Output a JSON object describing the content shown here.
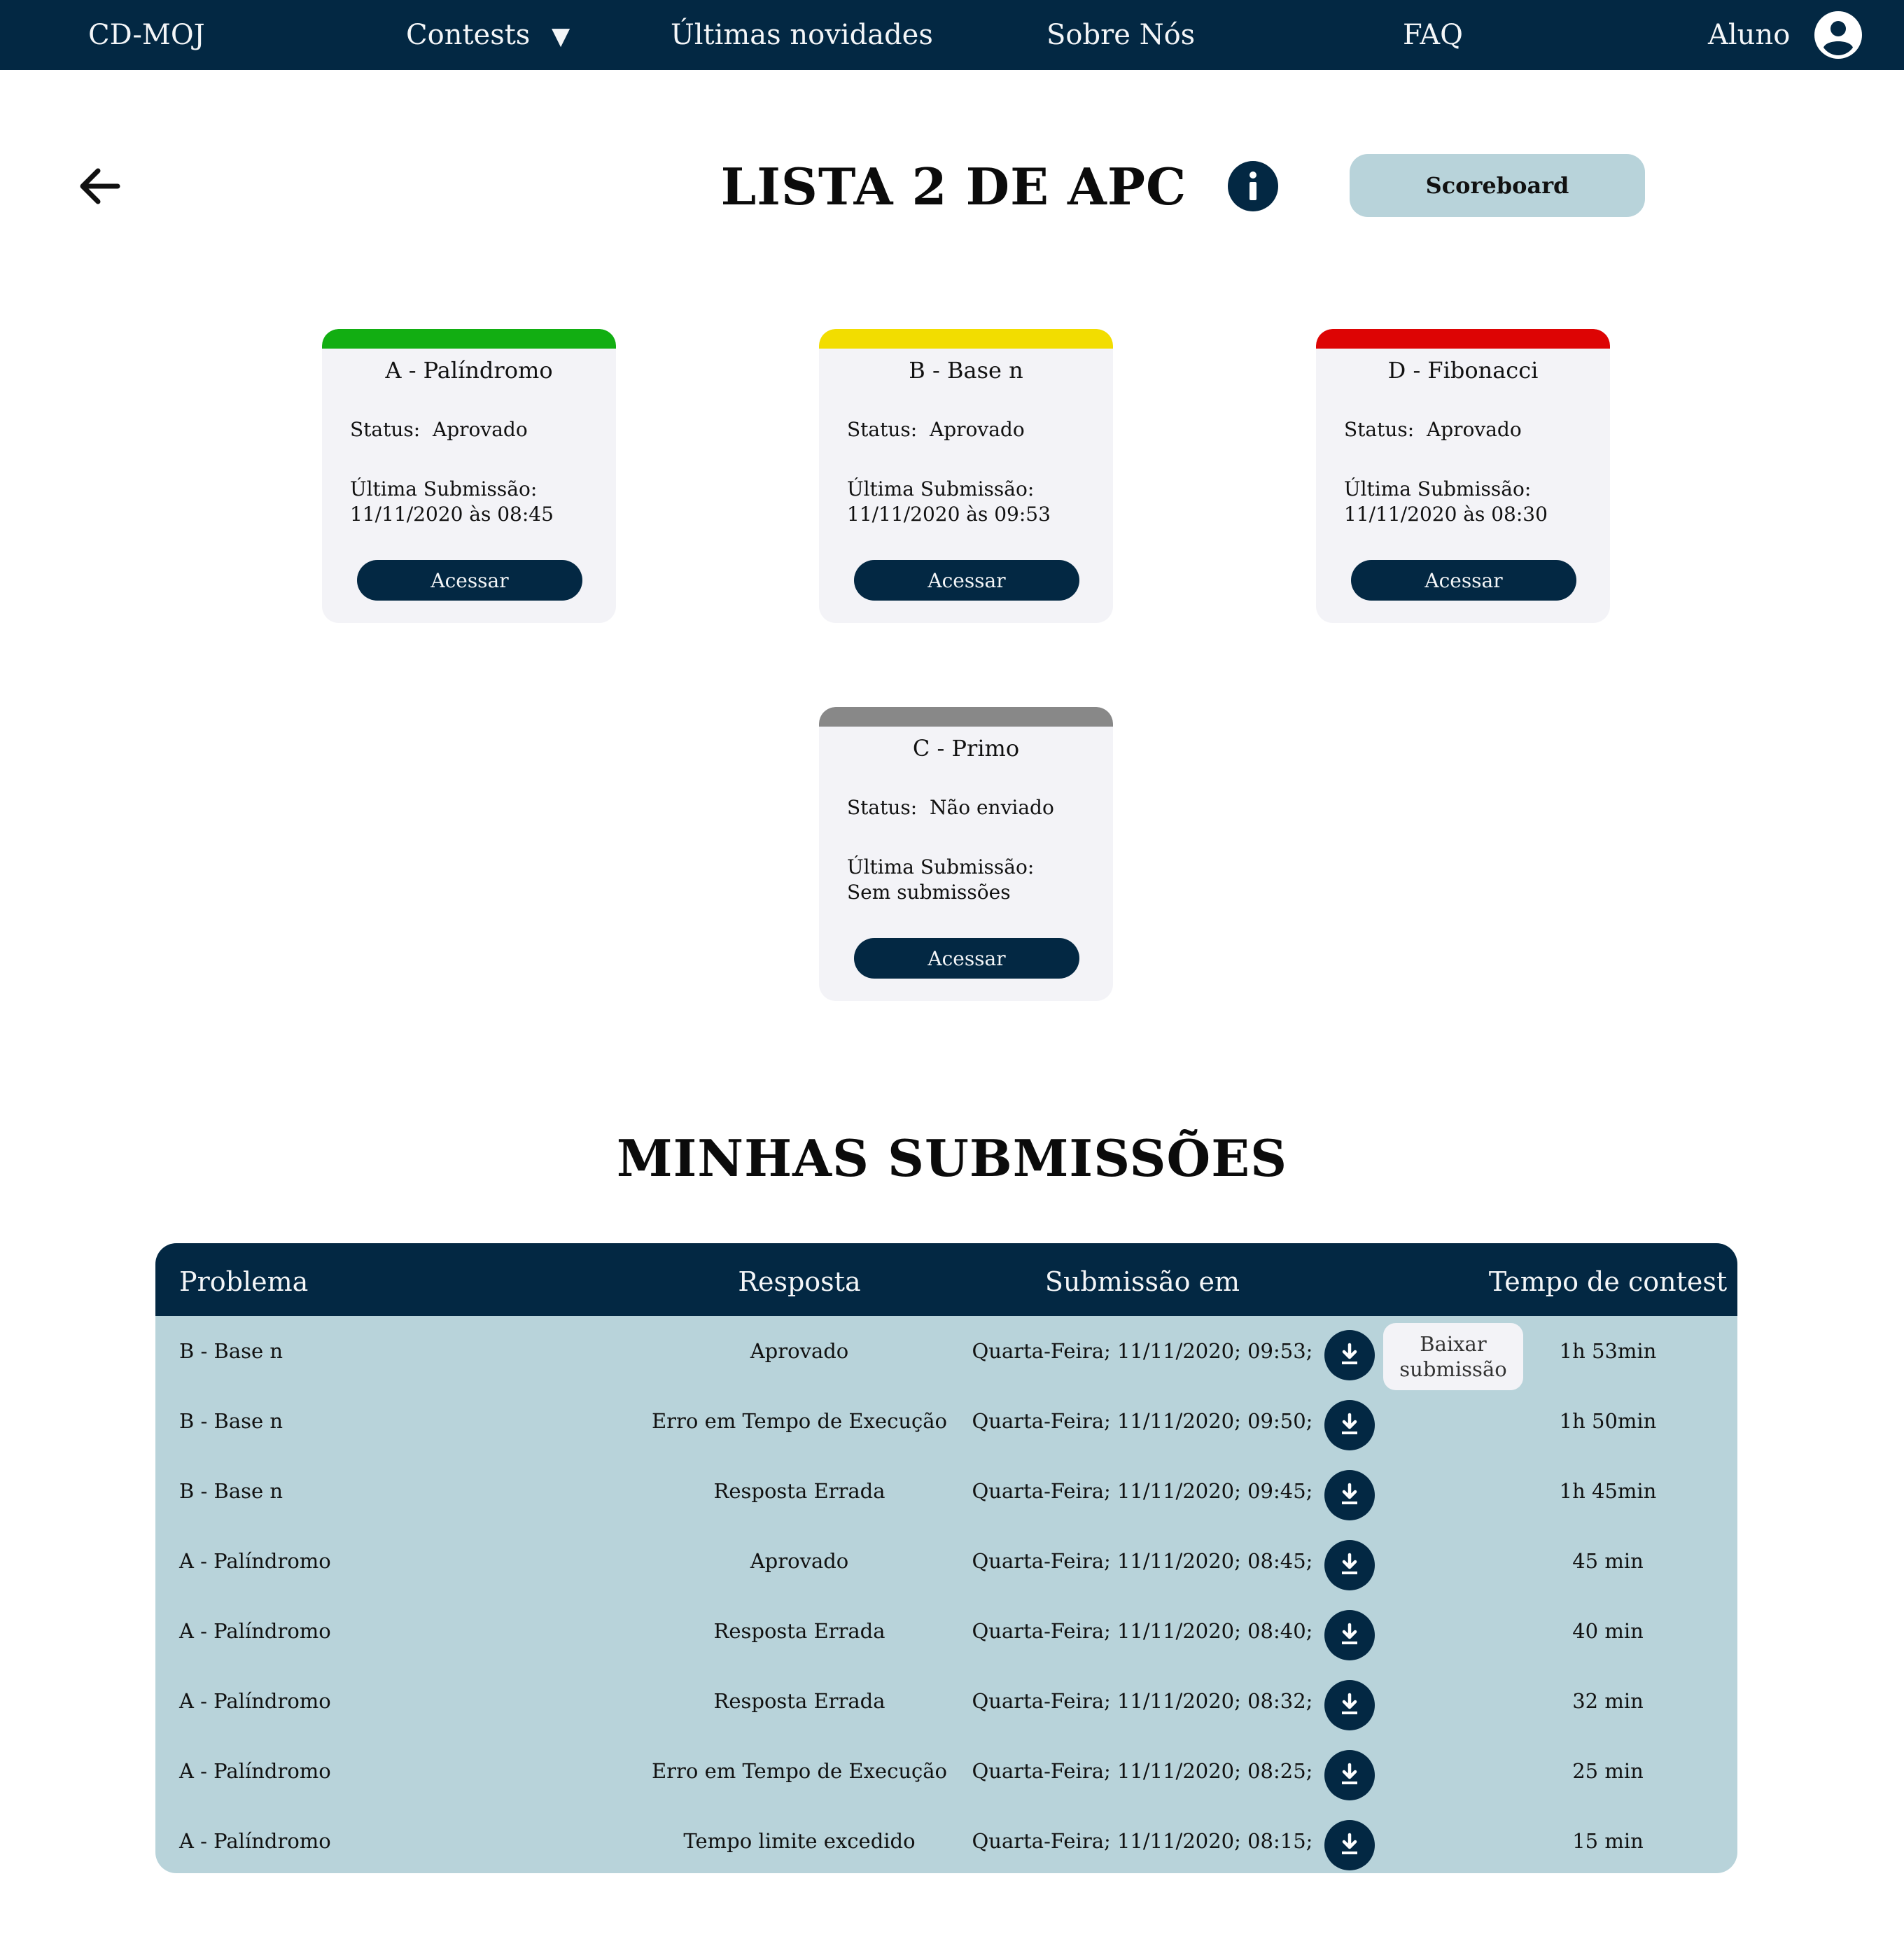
{
  "nav": {
    "brand": "CD-MOJ",
    "contests": "Contests",
    "contests_caret": "▼",
    "news": "Últimas novidades",
    "about": "Sobre Nós",
    "faq": "FAQ",
    "user": "Aluno"
  },
  "header": {
    "title": "LISTA 2 DE APC",
    "scoreboard_label": "Scoreboard"
  },
  "problems": [
    {
      "title": "A - Palíndromo",
      "status_text": "Status:  Aprovado",
      "last_sub_label": "Última Submissão:",
      "last_sub_value": "11/11/2020 às 08:45",
      "button": "Acessar",
      "color": "#12ae12"
    },
    {
      "title": "B - Base n",
      "status_text": "Status:  Aprovado",
      "last_sub_label": "Última Submissão:",
      "last_sub_value": "11/11/2020 às 09:53",
      "button": "Acessar",
      "color": "#f2dd00"
    },
    {
      "title": "D - Fibonacci",
      "status_text": "Status:  Aprovado",
      "last_sub_label": "Última Submissão:",
      "last_sub_value": "11/11/2020 às 08:30",
      "button": "Acessar",
      "color": "#dd0404"
    },
    {
      "title": "C - Primo",
      "status_text": "Status:  Não enviado",
      "last_sub_label": "Última Submissão:",
      "last_sub_value": "Sem submissões",
      "button": "Acessar",
      "color": "#888888"
    }
  ],
  "submissions": {
    "title": "MINHAS SUBMISSÕES",
    "columns": {
      "problem": "Problema",
      "answer": "Resposta",
      "submitted": "Submissão em",
      "time": "Tempo de contest"
    },
    "tooltip": "Baixar submissão",
    "rows": [
      {
        "problem": "B - Base n",
        "answer": "Aprovado",
        "submitted": "Quarta-Feira; 11/11/2020; 09:53;",
        "time": "1h 53min"
      },
      {
        "problem": "B - Base n",
        "answer": "Erro em Tempo de Execução",
        "submitted": "Quarta-Feira; 11/11/2020; 09:50;",
        "time": "1h 50min"
      },
      {
        "problem": "B - Base n",
        "answer": "Resposta Errada",
        "submitted": "Quarta-Feira; 11/11/2020; 09:45;",
        "time": "1h 45min"
      },
      {
        "problem": "A - Palíndromo",
        "answer": "Aprovado",
        "submitted": "Quarta-Feira; 11/11/2020; 08:45;",
        "time": "45 min"
      },
      {
        "problem": "A - Palíndromo",
        "answer": "Resposta Errada",
        "submitted": "Quarta-Feira; 11/11/2020; 08:40;",
        "time": "40 min"
      },
      {
        "problem": "A - Palíndromo",
        "answer": "Resposta Errada",
        "submitted": "Quarta-Feira; 11/11/2020; 08:32;",
        "time": "32 min"
      },
      {
        "problem": "A - Palíndromo",
        "answer": "Erro em Tempo de Execução",
        "submitted": "Quarta-Feira; 11/11/2020; 08:25;",
        "time": "25 min"
      },
      {
        "problem": "A - Palíndromo",
        "answer": "Tempo limite excedido",
        "submitted": "Quarta-Feira; 11/11/2020; 08:15;",
        "time": "15 min"
      }
    ]
  },
  "icons": {
    "back": "arrow-left-icon",
    "info": "info-icon",
    "user": "user-circle-icon",
    "download": "download-icon"
  },
  "colors": {
    "navy": "#032843",
    "table_bg": "#b8d3da",
    "card_bg": "#f3f3f7"
  }
}
